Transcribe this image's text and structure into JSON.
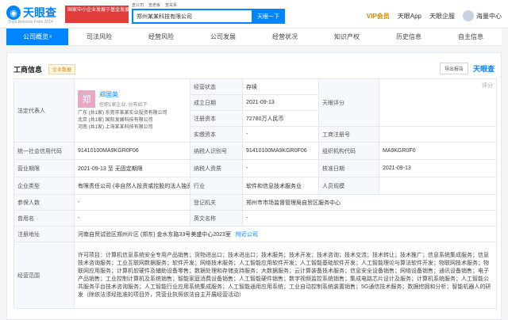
{
  "header": {
    "logo_text": "天眼查",
    "logo_sub": "Trust Records From 2014",
    "banner_text": "国家中小企业发展子基金发展 查看国家企业信用",
    "search_tabs": [
      "查公司",
      "查老板",
      "查关系"
    ],
    "search_query": "郑州某某科技有限公司",
    "search_button": "天眼一下",
    "vip_label": "VIP会员",
    "nav_items": [
      "天眼App",
      "天眼企服"
    ],
    "user_name": "海量中心"
  },
  "tabs": [
    {
      "label": "公司概览",
      "count": "4"
    },
    {
      "label": "司法风险",
      "count": ""
    },
    {
      "label": "经营风险",
      "count": ""
    },
    {
      "label": "公司发展",
      "count": ""
    },
    {
      "label": "经营状况",
      "count": ""
    },
    {
      "label": "知识产权",
      "count": ""
    },
    {
      "label": "历史信息",
      "count": ""
    },
    {
      "label": "自主信息",
      "count": ""
    }
  ],
  "panel": {
    "title": "工商信息",
    "tag": "企业数据",
    "actions": [
      "导出报告"
    ],
    "watermark": "天眼查"
  },
  "info": {
    "legal_rep_label": "法定代表人",
    "rep_logo": "郑",
    "rep_name": "郑国英",
    "rep_sub": "任职1家企业, 分布如下",
    "rep_list": [
      "广东 (共1家)  东莞市某某实业投资有限公司",
      "北京 (共1家)  国际发展科技有限公司",
      "河南 (共1家)  上海某某科技有限公司"
    ],
    "status_label": "经营状态",
    "status_value": "存续",
    "est_label": "成立日期",
    "est_value": "2021-09-13",
    "reg_cap_label": "注册资本",
    "reg_cap_value": "72780万人民币",
    "paid_cap_label": "实缴资本",
    "paid_cap_value": "-",
    "tianyan_score_label": "天眼评分",
    "tianyan_score_value": "评分",
    "biz_reg_label": "工商注册号",
    "biz_reg_value": "",
    "credit_code_label": "统一社会信用代码",
    "credit_code_value": "91410100MA9KGR0F06",
    "taxpayer_id_label": "纳税人识别号",
    "taxpayer_id_value": "91410100MA9KGR0F06",
    "org_code_label": "组织机构代码",
    "org_code_value": "MA9KGR0F0",
    "term_label": "营业期限",
    "term_value": "2021-09-13 至 无固定期限",
    "taxpayer_q_label": "纳税人资质",
    "taxpayer_q_value": "-",
    "approve_label": "核准日期",
    "approve_value": "2021-09-13",
    "type_label": "企业类型",
    "type_value": "有限责任公司 (非自然人投资或控股的法人独资)",
    "industry_label": "行业",
    "industry_value": "软件和信息技术服务业",
    "staff_label": "人员规模",
    "staff_value": "",
    "insured_label": "参保人数",
    "insured_value": "-",
    "reg_auth_label": "登记机关",
    "reg_auth_value": "郑州市市场监督管理局自贸区服务中心",
    "former_label": "曾用名",
    "former_value": "-",
    "eng_label": "英文名称",
    "eng_value": "-",
    "address_label": "注册地址",
    "address_value": "河南自贸试验区郑州片区 (郑东) 金水东路33号美盛中心2023室",
    "address_link": "附近公司",
    "scope_label": "经营范围",
    "scope_value": "许可项目：计算机信息系统安全专用产品销售；货物进出口；技术进出口；技术服务；技术开发；技术咨询；技术交流；技术转让；技术推广；信息系统集成服务；信息技术咨询服务；工业互联网数据服务；软件开发；网络技术服务；人工智能应用软件开发；人工智能基础软件开发；人工智能理论与算法软件开发；物联网技术服务；物联网应用服务；计算机软硬件及辅助设备零售；数据处理和存储支持服务；大数据服务；云计算装备技术服务；信息安全设备销售；网络设备销售；通讯设备销售；电子产品销售；工业控制计算机及系统销售；智能家庭消费设备销售；人工智能硬件销售；数字视频监控系统销售；集成电路芯片设计及服务；计算机系统服务；人工智能公共服务平台技术咨询服务；人工智能行业应用系统集成服务；人工智能通用应用系统；工业自动控制系统装置销售；5G通信技术服务；数据挖掘和分析；智能机器人的研发（除依法须经批准的项目外，凭营业执照依法自主开展经营活动）"
  }
}
